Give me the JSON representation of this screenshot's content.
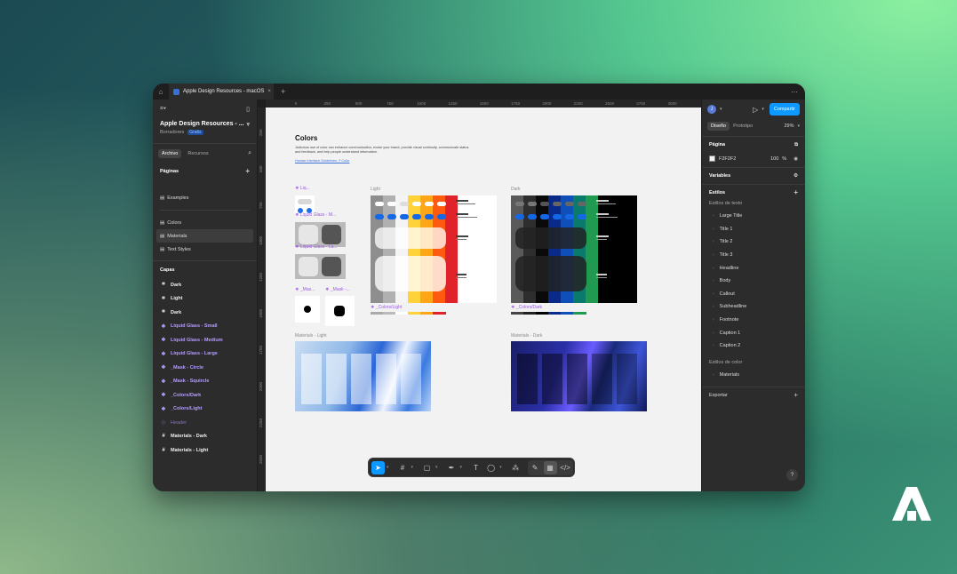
{
  "tabbar": {
    "tab_title": "Apple Design Resources - macOS",
    "plus": "+",
    "more": "⋯"
  },
  "file": {
    "name": "Apple Design Resources - ...",
    "location": "Borradores",
    "plan": "Gratis"
  },
  "left_tabs": {
    "file": "Archivo",
    "assets": "Recursos"
  },
  "pages": {
    "heading": "Páginas",
    "items": [
      "Examples",
      "Colors",
      "Materials",
      "Text Styles"
    ],
    "selected": "Materials"
  },
  "layers": {
    "heading": "Capas",
    "items": [
      {
        "label": "Dark",
        "kind": "frame"
      },
      {
        "label": "Light",
        "kind": "frame"
      },
      {
        "label": "Dark",
        "kind": "frame"
      },
      {
        "label": "Liquid Glass - Small",
        "kind": "component"
      },
      {
        "label": "Liquid Glass - Medium",
        "kind": "component"
      },
      {
        "label": "Liquid Glass - Large",
        "kind": "component"
      },
      {
        "label": "_Mask - Circle",
        "kind": "component"
      },
      {
        "label": "_Mask - Squircle",
        "kind": "component"
      },
      {
        "label": "_Colors/Dark",
        "kind": "component"
      },
      {
        "label": "_Colors/Light",
        "kind": "component"
      },
      {
        "label": "Header",
        "kind": "instance"
      },
      {
        "label": "Materials - Dark",
        "kind": "grid"
      },
      {
        "label": "Materials - Light",
        "kind": "grid"
      }
    ]
  },
  "ruler": {
    "h": [
      "0",
      "250",
      "500",
      "750",
      "1000",
      "1250",
      "1500",
      "1750",
      "2000",
      "2250",
      "2500",
      "2750",
      "3000"
    ],
    "v": [
      "250",
      "500",
      "750",
      "1000",
      "1250",
      "1500",
      "1750",
      "2000",
      "2250",
      "2500"
    ]
  },
  "board": {
    "title": "Colors",
    "description": "Judicious use of color can enhance communication, evoke your brand, provide visual continuity, communicate status and feedback, and help people understand information.",
    "link": "Human Interface Guidelines ↗ Color",
    "label_light": "Light",
    "label_dark": "Dark",
    "comp_liq": "❖ Liq...",
    "comp_liq_m": "❖ Liquid Glass - M...",
    "comp_liq_l": "❖ Liquid Glass - La...",
    "comp_mask_a": "❖ _Mas...",
    "comp_mask_b": "❖ _Mask -...",
    "colors_light": "❖ _Colors/Light",
    "colors_dark": "❖ _Colors/Dark",
    "materials_light": "Materials - Light",
    "materials_dark": "Materials - Dark"
  },
  "right": {
    "avatar": "J",
    "share": "Compartir",
    "tab_design": "Diseño",
    "tab_prototype": "Prototipo",
    "zoom": "29%",
    "page_heading": "Página",
    "page_color": "F2F2F2",
    "page_opacity": "100",
    "page_opacity_unit": "%",
    "variables": "Variables",
    "styles": "Estilos",
    "text_styles_heading": "Estilos de texto",
    "text_styles": [
      "Large Title",
      "Title 1",
      "Title 2",
      "Title 3",
      "Headline",
      "Body",
      "Callout",
      "Subheadline",
      "Footnote",
      "Caption 1",
      "Caption 2"
    ],
    "color_styles_heading": "Estilos de color",
    "color_styles": [
      "Materials"
    ],
    "export": "Exportar",
    "help": "?"
  },
  "colors": {
    "accent": "#0d99ff",
    "component": "#b59cff",
    "board": "#f2f2f2"
  }
}
